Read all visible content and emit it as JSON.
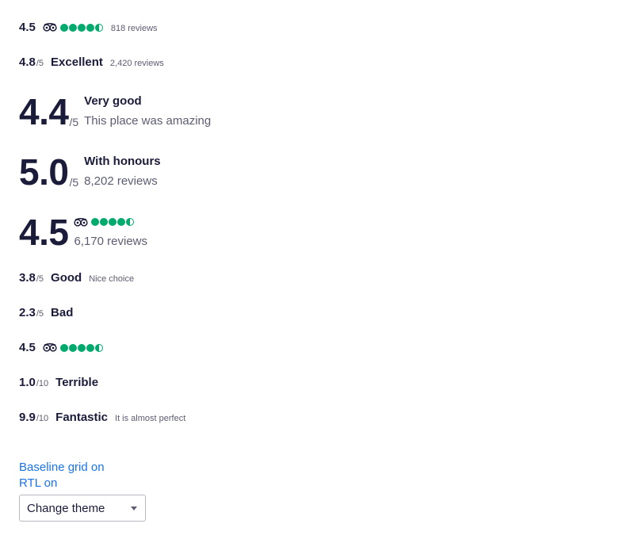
{
  "ratings": {
    "r1": {
      "score": "4.5",
      "provider_icon": "tripadvisor-owl-icon",
      "bubbles": 4.5,
      "reviews": "818 reviews"
    },
    "r2": {
      "score": "4.8",
      "scale": "/5",
      "label": "Excellent",
      "reviews": "2,420 reviews"
    },
    "r3": {
      "score": "4.4",
      "scale": "/5",
      "label": "Very good",
      "meta": "This place was amazing"
    },
    "r4": {
      "score": "5.0",
      "scale": "/5",
      "label": "With honours",
      "meta": "8,202 reviews"
    },
    "r5": {
      "score": "4.5",
      "provider_icon": "tripadvisor-owl-icon",
      "bubbles": 4.5,
      "reviews": "6,170 reviews"
    },
    "r6": {
      "score": "3.8",
      "scale": "/5",
      "label": "Good",
      "meta": "Nice choice"
    },
    "r7": {
      "score": "2.3",
      "scale": "/5",
      "label": "Bad"
    },
    "r8": {
      "score": "4.5",
      "provider_icon": "tripadvisor-owl-icon",
      "bubbles": 4.5
    },
    "r9": {
      "score": "1.0",
      "scale": "/10",
      "label": "Terrible"
    },
    "r10": {
      "score": "9.9",
      "scale": "/10",
      "label": "Fantastic",
      "meta": "It is almost perfect"
    }
  },
  "controls": {
    "baseline_grid": "Baseline grid on",
    "rtl": "RTL on",
    "theme_select": "Change theme",
    "caret_icon": "chevron-down-icon"
  },
  "colors": {
    "text": "#1b1b3a",
    "muted": "#5c5c73",
    "tripadvisor_green": "#00aa6c",
    "link": "#1a73e8"
  }
}
